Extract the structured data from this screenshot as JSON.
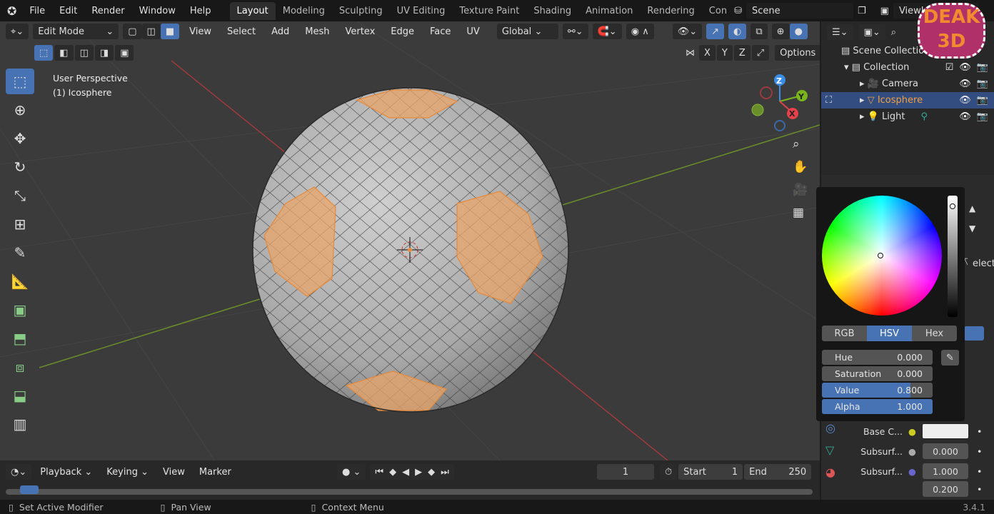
{
  "menu": [
    "File",
    "Edit",
    "Render",
    "Window",
    "Help"
  ],
  "workspaces": [
    "Layout",
    "Modeling",
    "Sculpting",
    "UV Editing",
    "Texture Paint",
    "Shading",
    "Animation",
    "Rendering",
    "Con"
  ],
  "scene": "Scene",
  "view_layer": "ViewLayer",
  "header": {
    "mode": "Edit Mode",
    "menus": [
      "View",
      "Select",
      "Add",
      "Mesh",
      "Vertex",
      "Edge",
      "Face",
      "UV"
    ],
    "orientation": "Global",
    "options": "Options",
    "axes": [
      "X",
      "Y",
      "Z"
    ]
  },
  "viewport": {
    "view_name": "User Perspective",
    "object": "(1) Icosphere",
    "gizmo": {
      "x": "X",
      "y": "Y",
      "z": "Z"
    }
  },
  "outliner": {
    "root": "Scene Collection",
    "collection": "Collection",
    "items": [
      "Camera",
      "Icosphere",
      "Light"
    ]
  },
  "color_picker": {
    "tabs": [
      "RGB",
      "HSV",
      "Hex"
    ],
    "active_tab": "HSV",
    "fields": [
      {
        "label": "Hue",
        "value": "0.000",
        "fill": 0
      },
      {
        "label": "Saturation",
        "value": "0.000",
        "fill": 0
      },
      {
        "label": "Value",
        "value": "0.800",
        "fill": 0.8
      },
      {
        "label": "Alpha",
        "value": "1.000",
        "fill": 1
      }
    ]
  },
  "properties": {
    "select_partial": "elect",
    "rows": [
      {
        "label": "Base C...",
        "value": ""
      },
      {
        "label": "Subsurf...",
        "value": "0.000"
      },
      {
        "label": "Subsurf...",
        "value": "1.000"
      },
      {
        "label": "",
        "value": "0.200"
      }
    ]
  },
  "timeline": {
    "menus": [
      "Playback",
      "Keying",
      "View",
      "Marker"
    ],
    "current_frame": "1",
    "start_label": "Start",
    "start": "1",
    "end_label": "End",
    "end": "250"
  },
  "status": {
    "items": [
      "Set Active Modifier",
      "Pan View",
      "Context Menu"
    ],
    "version": "3.4.1"
  },
  "watermark": "DEAK 3D"
}
